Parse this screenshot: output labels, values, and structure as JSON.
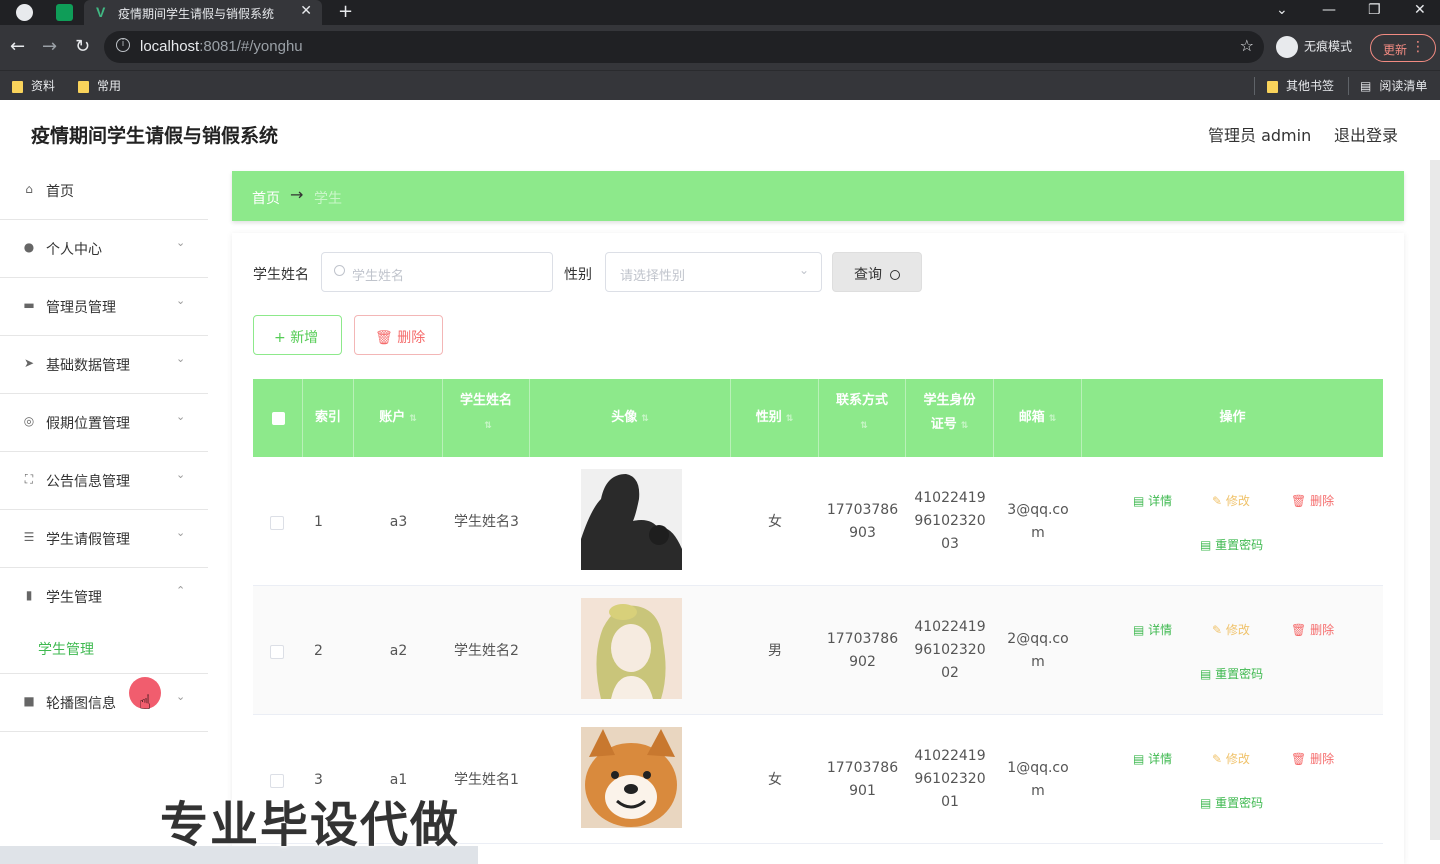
{
  "browser": {
    "tab_title": "疫情期间学生请假与销假系统",
    "url_host": "localhost",
    "url_rest": ":8081/#/yonghu",
    "incognito_label": "无痕模式",
    "update_label": "更新",
    "bookmarks": [
      "资料",
      "常用"
    ],
    "bookmarks_right": [
      "其他书签",
      "阅读清单"
    ]
  },
  "header": {
    "title": "疫情期间学生请假与销假系统",
    "user": "管理员 admin",
    "logout": "退出登录"
  },
  "sidebar": {
    "items": [
      {
        "label": "首页",
        "icon": "home-icon"
      },
      {
        "label": "个人中心",
        "icon": "user-icon"
      },
      {
        "label": "管理员管理",
        "icon": "folder-icon"
      },
      {
        "label": "基础数据管理",
        "icon": "send-icon"
      },
      {
        "label": "假期位置管理",
        "icon": "target-icon"
      },
      {
        "label": "公告信息管理",
        "icon": "frame-icon"
      },
      {
        "label": "学生请假管理",
        "icon": "sliders-icon"
      },
      {
        "label": "学生管理",
        "icon": "chart-icon"
      },
      {
        "label": "轮播图信息",
        "icon": "video-icon"
      }
    ],
    "active_sub": "学生管理"
  },
  "breadcrumb": {
    "home": "首页",
    "current": "学生"
  },
  "filters": {
    "name_label": "学生姓名",
    "name_placeholder": "学生姓名",
    "gender_label": "性别",
    "gender_placeholder": "请选择性别",
    "query_label": "查询"
  },
  "actions": {
    "add_label": "新增",
    "delete_label": "删除"
  },
  "table": {
    "columns": [
      "索引",
      "账户",
      "学生姓名",
      "头像",
      "性别",
      "联系方式",
      "学生身份证号",
      "邮箱",
      "操作"
    ],
    "ops": {
      "detail": "详情",
      "edit": "修改",
      "delete": "删除",
      "reset": "重置密码"
    },
    "rows": [
      {
        "index": "1",
        "account": "a3",
        "name": "学生姓名3",
        "gender": "女",
        "phone": [
          "17703786",
          "903"
        ],
        "idcard": [
          "41022419",
          "96102320",
          "03"
        ],
        "email": [
          "3@qq.co",
          "m"
        ]
      },
      {
        "index": "2",
        "account": "a2",
        "name": "学生姓名2",
        "gender": "男",
        "phone": [
          "17703786",
          "902"
        ],
        "idcard": [
          "41022419",
          "96102320",
          "02"
        ],
        "email": [
          "2@qq.co",
          "m"
        ]
      },
      {
        "index": "3",
        "account": "a1",
        "name": "学生姓名1",
        "gender": "女",
        "phone": [
          "17703786",
          "901"
        ],
        "idcard": [
          "41022419",
          "96102320",
          "01"
        ],
        "email": [
          "1@qq.co",
          "m"
        ]
      }
    ]
  },
  "watermark": "专业毕设代做",
  "colors": {
    "accent_green": "#8de98b",
    "text_green": "#3fb950",
    "danger": "#f56c6c",
    "warn": "#f0c36c"
  }
}
